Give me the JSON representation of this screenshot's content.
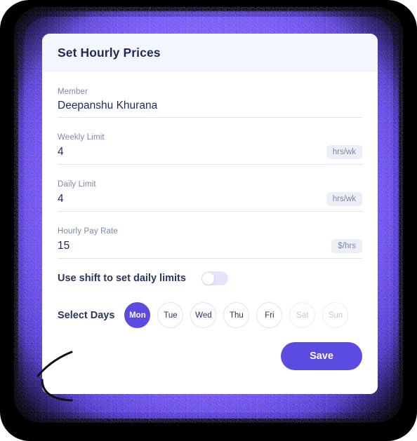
{
  "modal": {
    "title": "Set Hourly Prices",
    "fields": [
      {
        "label": "Member",
        "value": "Deepanshu Khurana",
        "suffix": ""
      },
      {
        "label": "Weekly Limit",
        "value": "4",
        "suffix": "hrs/wk"
      },
      {
        "label": "Daily Limit",
        "value": "4",
        "suffix": "hrs/wk"
      },
      {
        "label": "Hourly Pay Rate",
        "value": "15",
        "suffix": "$/hrs"
      }
    ],
    "toggle": {
      "label": "Use shift to set daily limits",
      "state": "off"
    },
    "days": {
      "label": "Select Days",
      "options": [
        {
          "label": "Mon",
          "state": "selected"
        },
        {
          "label": "Tue",
          "state": "normal"
        },
        {
          "label": "Wed",
          "state": "normal"
        },
        {
          "label": "Thu",
          "state": "normal"
        },
        {
          "label": "Fri",
          "state": "normal"
        },
        {
          "label": "Sat",
          "state": "disabled"
        },
        {
          "label": "Sun",
          "state": "disabled"
        }
      ]
    },
    "save_label": "Save"
  },
  "colors": {
    "accent": "#5B4BE0",
    "header_bg": "#F3F6FC",
    "text_dark": "#1F2A5A",
    "text_muted": "#7C87A6",
    "badge_bg": "#ECEFF6",
    "glow": "#6E4AF6"
  }
}
